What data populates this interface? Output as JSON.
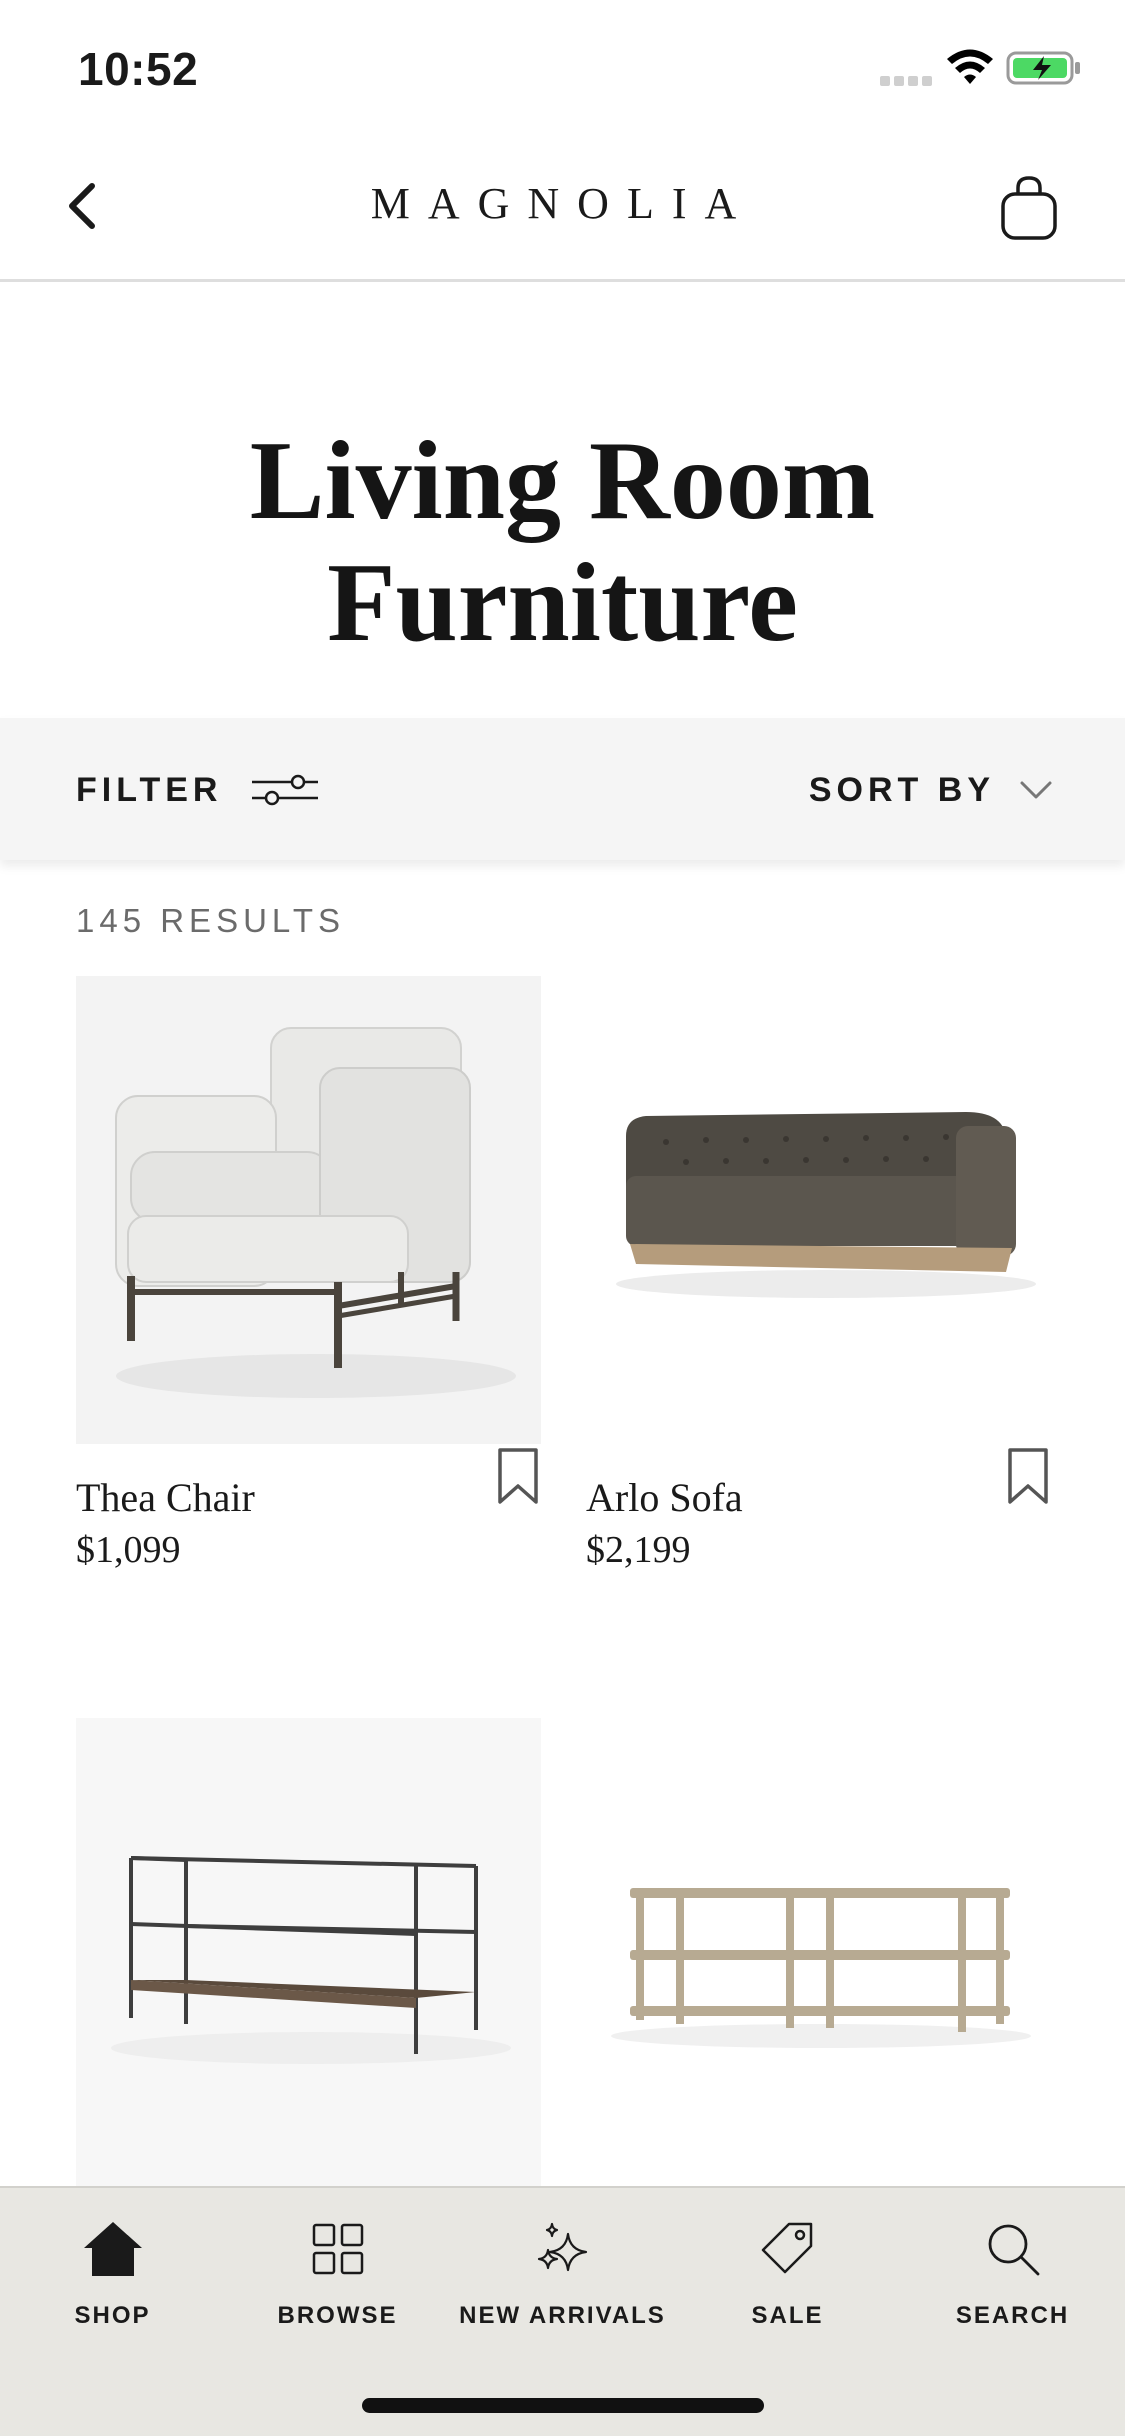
{
  "status_bar": {
    "time": "10:52"
  },
  "header": {
    "brand": "MAGNOLIA"
  },
  "page": {
    "title_line1": "Living Room",
    "title_line2": "Furniture"
  },
  "toolbar": {
    "filter_label": "FILTER",
    "sort_label": "SORT BY"
  },
  "results": {
    "count_text": "145 RESULTS"
  },
  "products": [
    {
      "name": "Thea Chair",
      "price": "$1,099"
    },
    {
      "name": "Arlo Sofa",
      "price": "$2,199"
    },
    {
      "name": "",
      "price": ""
    },
    {
      "name": "",
      "price": ""
    }
  ],
  "tabs": [
    {
      "label": "SHOP",
      "icon": "home-icon",
      "active": true
    },
    {
      "label": "BROWSE",
      "icon": "grid-icon",
      "active": false
    },
    {
      "label": "NEW ARRIVALS",
      "icon": "sparkle-icon",
      "active": false
    },
    {
      "label": "SALE",
      "icon": "tag-icon",
      "active": false
    },
    {
      "label": "SEARCH",
      "icon": "search-icon",
      "active": false
    }
  ],
  "colors": {
    "text": "#1a1a1a",
    "muted": "#6b6b6b",
    "filter_bar_bg": "#f5f5f5",
    "tab_bar_bg": "#e8e7e2",
    "battery_fill": "#4cd964"
  }
}
